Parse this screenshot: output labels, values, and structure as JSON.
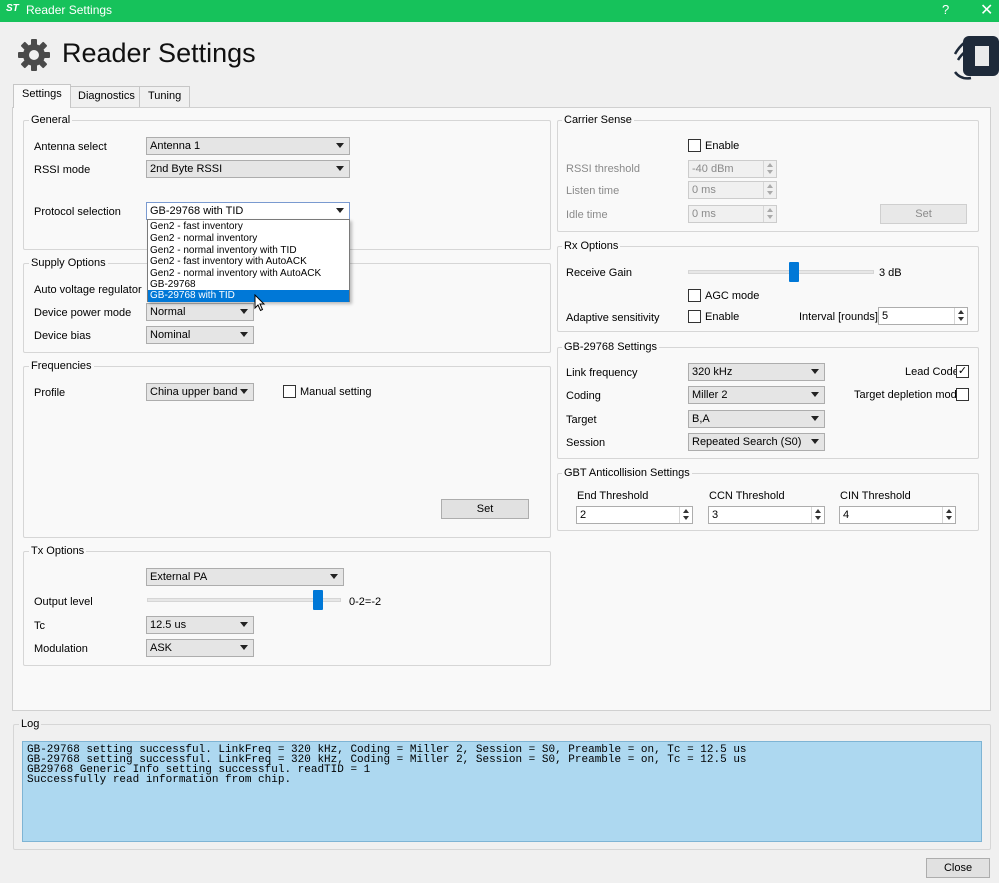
{
  "window": {
    "title": "Reader Settings",
    "help_glyph": "?",
    "close_glyph": "✕",
    "app_logo": "ST"
  },
  "header": {
    "title": "Reader Settings",
    "icon": "gear-icon"
  },
  "tabs": [
    {
      "label": "Settings",
      "active": true
    },
    {
      "label": "Diagnostics"
    },
    {
      "label": "Tuning"
    }
  ],
  "general": {
    "title": "General",
    "antenna_label": "Antenna select",
    "antenna_value": "Antenna 1",
    "rssi_label": "RSSI mode",
    "rssi_value": "2nd Byte RSSI",
    "protocol_label": "Protocol selection",
    "protocol_value": "GB-29768 with TID",
    "protocol_options": [
      "Gen2 - fast inventory",
      "Gen2 - normal inventory",
      "Gen2 - normal inventory with TID",
      "Gen2 - fast inventory with AutoACK",
      "Gen2 - normal inventory with AutoACK",
      "GB-29768",
      "GB-29768 with TID"
    ],
    "protocol_selected_index": 6
  },
  "supply": {
    "title": "Supply Options",
    "avr_label": "Auto voltage regulator",
    "power_mode_label": "Device power mode",
    "power_mode_value": "Normal",
    "bias_label": "Device bias",
    "bias_value": "Nominal"
  },
  "frequencies": {
    "title": "Frequencies",
    "profile_label": "Profile",
    "profile_value": "China upper band",
    "manual_label": "Manual setting",
    "manual_checked": false,
    "set_label": "Set"
  },
  "tx": {
    "title": "Tx Options",
    "pa_value": "External PA",
    "output_label": "Output level",
    "output_value_text": "0-2=-2",
    "output_fraction": 0.88,
    "tc_label": "Tc",
    "tc_value": "12.5 us",
    "modulation_label": "Modulation",
    "modulation_value": "ASK"
  },
  "carrier": {
    "title": "Carrier Sense",
    "enable_label": "Enable",
    "enable_checked": false,
    "rssi_label": "RSSI threshold",
    "rssi_value": "-40 dBm",
    "listen_label": "Listen time",
    "listen_value": "0 ms",
    "idle_label": "Idle time",
    "idle_value": "0 ms",
    "set_label": "Set"
  },
  "rx": {
    "title": "Rx Options",
    "gain_label": "Receive Gain",
    "gain_value_text": "3 dB",
    "gain_fraction": 0.57,
    "agc_label": "AGC mode",
    "agc_checked": false,
    "adaptive_label": "Adaptive sensitivity",
    "adaptive_enable_label": "Enable",
    "adaptive_checked": false,
    "interval_label": "Interval [rounds]",
    "interval_value": "5"
  },
  "gb": {
    "title": "GB-29768 Settings",
    "link_label": "Link frequency",
    "link_value": "320 kHz",
    "coding_label": "Coding",
    "coding_value": "Miller 2",
    "target_label": "Target",
    "target_value": "B,A",
    "session_label": "Session",
    "session_value": "Repeated Search (S0)",
    "lead_label": "Lead Code",
    "lead_checked": true,
    "check_glyph": "✓",
    "depletion_label": "Target depletion mode",
    "depletion_checked": false
  },
  "gbt": {
    "title": "GBT Anticollision Settings",
    "end_label": "End Threshold",
    "end_value": "2",
    "ccn_label": "CCN Threshold",
    "ccn_value": "3",
    "cin_label": "CIN Threshold",
    "cin_value": "4"
  },
  "log": {
    "title": "Log",
    "text": "GB-29768 setting successful. LinkFreq = 320 kHz, Coding = Miller 2, Session = S0, Preamble = on, Tc = 12.5 us\nGB-29768 setting successful. LinkFreq = 320 kHz, Coding = Miller 2, Session = S0, Preamble = on, Tc = 12.5 us\nGB29768 Generic Info setting successful. readTID = 1\nSuccessfully read information from chip."
  },
  "footer": {
    "close_label": "Close"
  },
  "colors": {
    "titlebar": "#16c25b",
    "accent": "#0078d7",
    "log_bg": "#add8f0"
  }
}
